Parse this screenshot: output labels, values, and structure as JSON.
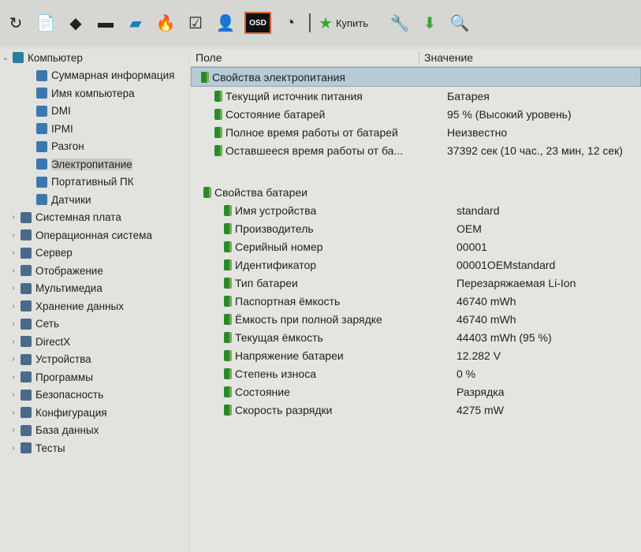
{
  "toolbar": {
    "items": [
      {
        "icon": "refresh-icon"
      },
      {
        "icon": "report-icon"
      },
      {
        "icon": "drive-icon"
      },
      {
        "icon": "memory-icon"
      },
      {
        "icon": "network-icon"
      },
      {
        "icon": "stress-test-icon"
      },
      {
        "icon": "checklist-icon"
      },
      {
        "icon": "user-icon"
      },
      {
        "icon": "osd-icon",
        "label": "OSD"
      },
      {
        "icon": "gauge-icon"
      }
    ],
    "buy_label": "Купить",
    "tail": [
      {
        "icon": "tools-icon"
      },
      {
        "icon": "download-icon"
      },
      {
        "icon": "search-icon"
      }
    ]
  },
  "tree": {
    "root": "Компьютер",
    "children": [
      "Суммарная информация",
      "Имя компьютера",
      "DMI",
      "IPMI",
      "Разгон",
      "Электропитание",
      "Портативный ПК",
      "Датчики"
    ],
    "selected": "Электропитание",
    "groups": [
      "Системная плата",
      "Операционная система",
      "Сервер",
      "Отображение",
      "Мультимедиа",
      "Хранение данных",
      "Сеть",
      "DirectX",
      "Устройства",
      "Программы",
      "Безопасность",
      "Конфигурация",
      "База данных",
      "Тесты"
    ]
  },
  "table": {
    "col_field": "Поле",
    "col_value": "Значение",
    "group1": "Свойства электропитания",
    "rows1": [
      {
        "f": "Текущий источник питания",
        "v": "Батарея"
      },
      {
        "f": "Состояние батарей",
        "v": "95 % (Высокий уровень)"
      },
      {
        "f": "Полное время работы от батарей",
        "v": "Неизвестно"
      },
      {
        "f": "Оставшееся время работы от ба...",
        "v": "37392 сек (10 час., 23 мин, 12 сек)"
      }
    ],
    "group2": "Свойства батареи",
    "rows2": [
      {
        "f": "Имя устройства",
        "v": "standard"
      },
      {
        "f": "Производитель",
        "v": "OEM"
      },
      {
        "f": "Серийный номер",
        "v": "00001"
      },
      {
        "f": "Идентификатор",
        "v": "00001OEMstandard"
      },
      {
        "f": "Тип батареи",
        "v": "Перезаряжаемая Li-Ion"
      },
      {
        "f": "Паспортная ёмкость",
        "v": "46740 mWh"
      },
      {
        "f": "Ёмкость при полной зарядке",
        "v": "46740 mWh"
      },
      {
        "f": "Текущая ёмкость",
        "v": "44403 mWh  (95 %)"
      },
      {
        "f": "Напряжение батареи",
        "v": "12.282 V"
      },
      {
        "f": "Степень износа",
        "v": "0 %"
      },
      {
        "f": "Состояние",
        "v": "Разрядка"
      },
      {
        "f": "Скорость разрядки",
        "v": "4275 mW"
      }
    ]
  }
}
